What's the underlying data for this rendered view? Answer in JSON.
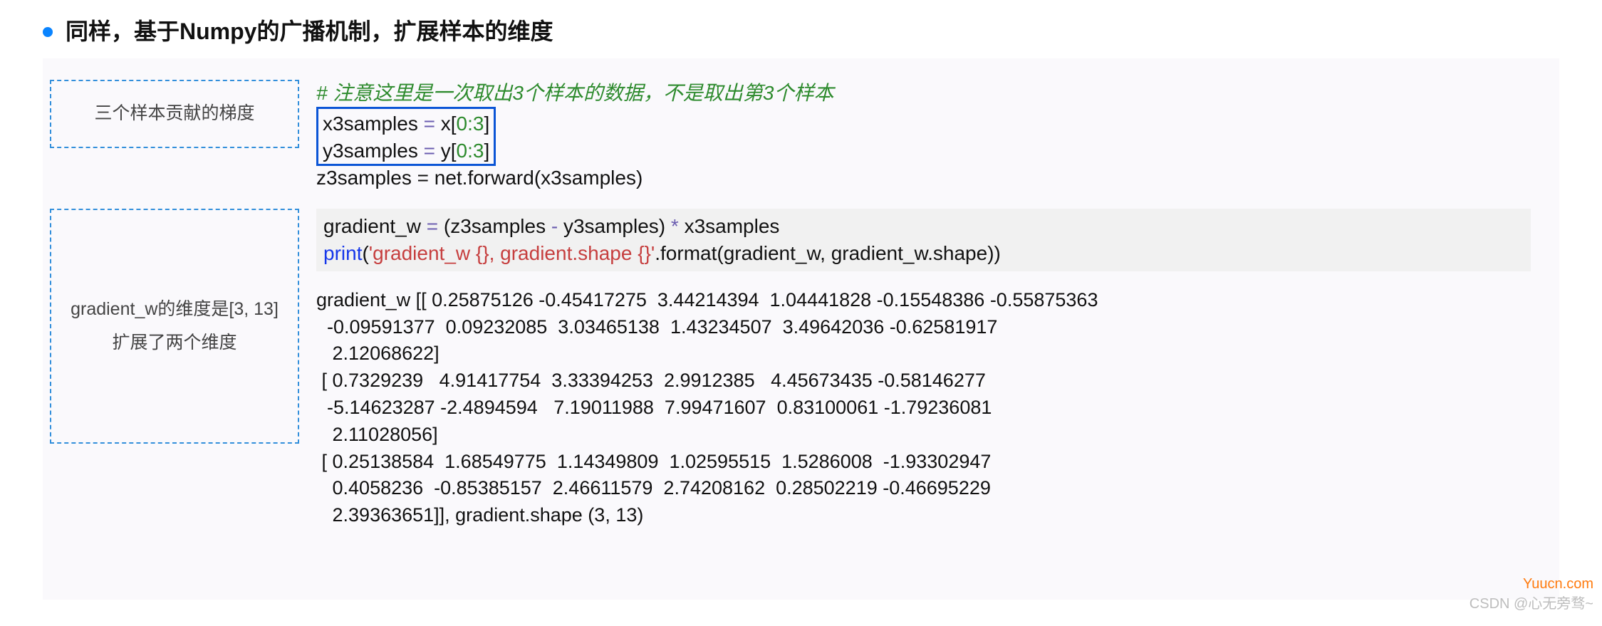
{
  "heading": "同样，基于Numpy的广播机制，扩展样本的维度",
  "row1": {
    "label": "三个样本贡献的梯度",
    "code": {
      "comment": "# 注意这里是一次取出3个样本的数据，不是取出第3个样本",
      "line1_var": "x3samples ",
      "line1_eq": "=",
      "line1_x": " x",
      "line1_br1": "[",
      "line1_slice": "0:3",
      "line1_br2": "]",
      "line2_var": "y3samples ",
      "line2_eq": "=",
      "line2_y": " y",
      "line2_br1": "[",
      "line2_slice": "0:3",
      "line2_br2": "]",
      "line3": "z3samples = net.forward(x3samples)"
    }
  },
  "row2": {
    "label_line1": "gradient_w的维度是[3, 13]",
    "label_line2": "扩展了两个维度",
    "code": {
      "line1_a": "gradient_w ",
      "line1_eq": "=",
      "line1_b": " (z3samples ",
      "line1_minus": "-",
      "line1_c": " y3samples) ",
      "line1_mul": "*",
      "line1_d": " x3samples",
      "line2_print": "print",
      "line2_open": "(",
      "line2_str": "'gradient_w {}, gradient.shape {}'",
      "line2_rest": ".format(gradient_w, gradient_w.shape))"
    },
    "output": "gradient_w [[ 0.25875126 -0.45417275  3.44214394  1.04441828 -0.15548386 -0.55875363\n  -0.09591377  0.09232085  3.03465138  1.43234507  3.49642036 -0.62581917\n   2.12068622]\n [ 0.7329239   4.91417754  3.33394253  2.9912385   4.45673435 -0.58146277\n  -5.14623287 -2.4894594   7.19011988  7.99471607  0.83100061 -1.79236081\n   2.11028056]\n [ 0.25138584  1.68549775  1.14349809  1.02595515  1.5286008  -1.93302947\n   0.4058236  -0.85385157  2.46611579  2.74208162  0.28502219 -0.46695229\n   2.39363651]], gradient.shape (3, 13)"
  },
  "watermark_right": "Yuucn.com",
  "watermark_bottom": "CSDN @心无旁骛~"
}
